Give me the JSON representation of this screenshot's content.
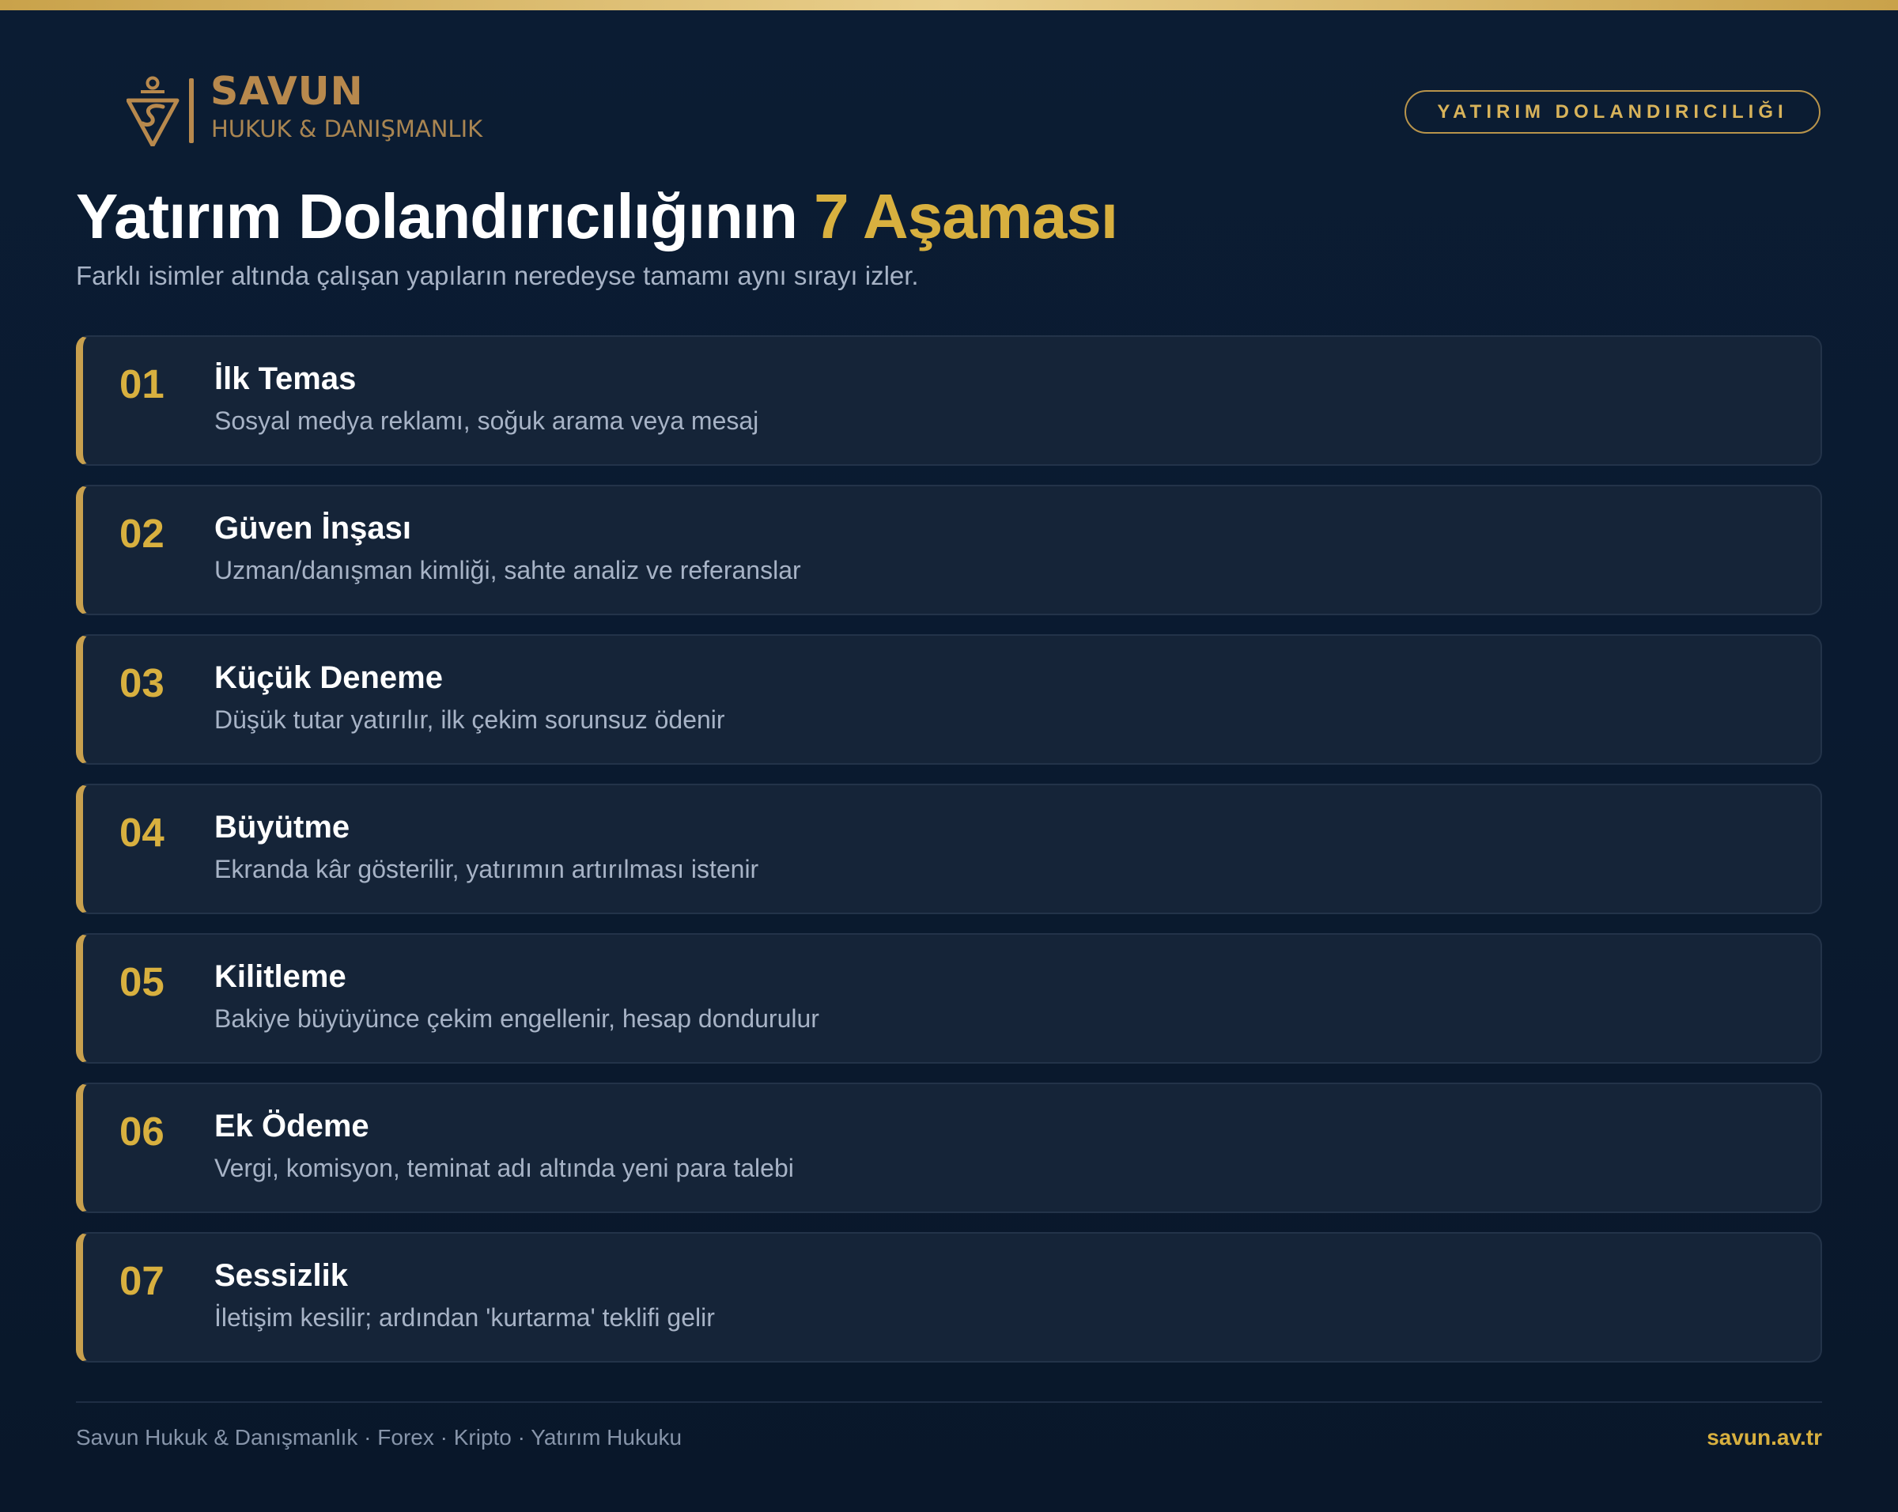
{
  "brand": {
    "name": "SAVUN",
    "subtitle": "HUKUK & DANIŞMANLIK",
    "color": "#b8894d"
  },
  "badge": {
    "label": "YATIRIM DOLANDIRICILIĞI"
  },
  "header": {
    "title_main": "Yatırım Dolandırıcılığının",
    "title_accent": "7 Aşaması",
    "subtitle": "Farklı isimler altında çalışan yapıların neredeyse tamamı aynı sırayı izler."
  },
  "colors": {
    "background": "#0b1c33",
    "accent": "#d8b03f",
    "card": "#152438",
    "text_muted": "#a7b3c6"
  },
  "steps": [
    {
      "number": "01",
      "title": "İlk Temas",
      "description": "Sosyal medya reklamı, soğuk arama veya mesaj"
    },
    {
      "number": "02",
      "title": "Güven İnşası",
      "description": "Uzman/danışman kimliği, sahte analiz ve referanslar"
    },
    {
      "number": "03",
      "title": "Küçük Deneme",
      "description": "Düşük tutar yatırılır, ilk çekim sorunsuz ödenir"
    },
    {
      "number": "04",
      "title": "Büyütme",
      "description": "Ekranda kâr gösterilir, yatırımın artırılması istenir"
    },
    {
      "number": "05",
      "title": "Kilitleme",
      "description": "Bakiye büyüyünce çekim engellenir, hesap dondurulur"
    },
    {
      "number": "06",
      "title": "Ek Ödeme",
      "description": "Vergi, komisyon, teminat adı altında yeni para talebi"
    },
    {
      "number": "07",
      "title": "Sessizlik",
      "description": "İletişim kesilir; ardından 'kurtarma' teklifi gelir"
    }
  ],
  "footer": {
    "left_text": "Savun Hukuk & Danışmanlık · Forex · Kripto · Yatırım Hukuku",
    "website": "savun.av.tr"
  }
}
